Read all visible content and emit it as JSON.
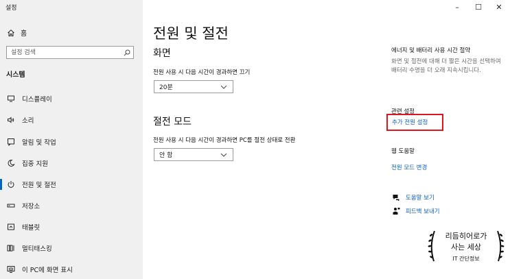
{
  "window": {
    "title": "설정",
    "controls": {
      "minimize": "–",
      "maximize": "☐",
      "close": "✕"
    }
  },
  "sidebar": {
    "home_label": "홈",
    "search_placeholder": "설정 검색",
    "section_title": "시스템",
    "items": [
      {
        "label": "디스플레이",
        "icon": "monitor-icon"
      },
      {
        "label": "소리",
        "icon": "speaker-icon"
      },
      {
        "label": "알림 및 작업",
        "icon": "notification-icon"
      },
      {
        "label": "집중 지원",
        "icon": "moon-icon"
      },
      {
        "label": "전원 및 절전",
        "icon": "power-icon",
        "active": true
      },
      {
        "label": "저장소",
        "icon": "storage-icon"
      },
      {
        "label": "태블릿",
        "icon": "tablet-icon"
      },
      {
        "label": "멀티태스킹",
        "icon": "multitasking-icon"
      },
      {
        "label": "이 PC에 화면 표시",
        "icon": "project-icon"
      }
    ]
  },
  "main": {
    "title": "전원 및 절전",
    "screen": {
      "heading": "화면",
      "label": "전원 사용 시 다음 시간이 경과하면 끄기",
      "value": "20분"
    },
    "sleep": {
      "heading": "절전 모드",
      "label": "전원 사용 시 다음 시간이 경과하면 PC를 절전 상태로 전환",
      "value": "안 함"
    }
  },
  "right_panel": {
    "energy_title": "에너지 및 배터리 사용 시간 절약",
    "energy_desc": "화면 및 절전에 대해 더 짧은 시간을 선택하여 배터리 수명을 더 오래 지속시킵니다.",
    "related_title": "관련 설정",
    "related_link": "추가 전원 설정",
    "help_title": "웹 도움말",
    "help_link": "전원 모드 변경",
    "get_help": "도움말 보기",
    "feedback": "피드백 보내기"
  },
  "watermark": {
    "line1": "리듬히어로가",
    "line2": "사는 세상",
    "line3": "IT 간단정보"
  },
  "colors": {
    "accent": "#0067c0",
    "link": "#0b5fc7",
    "highlight": "#e0141c",
    "sidebar_bg": "#f0f0f0"
  }
}
